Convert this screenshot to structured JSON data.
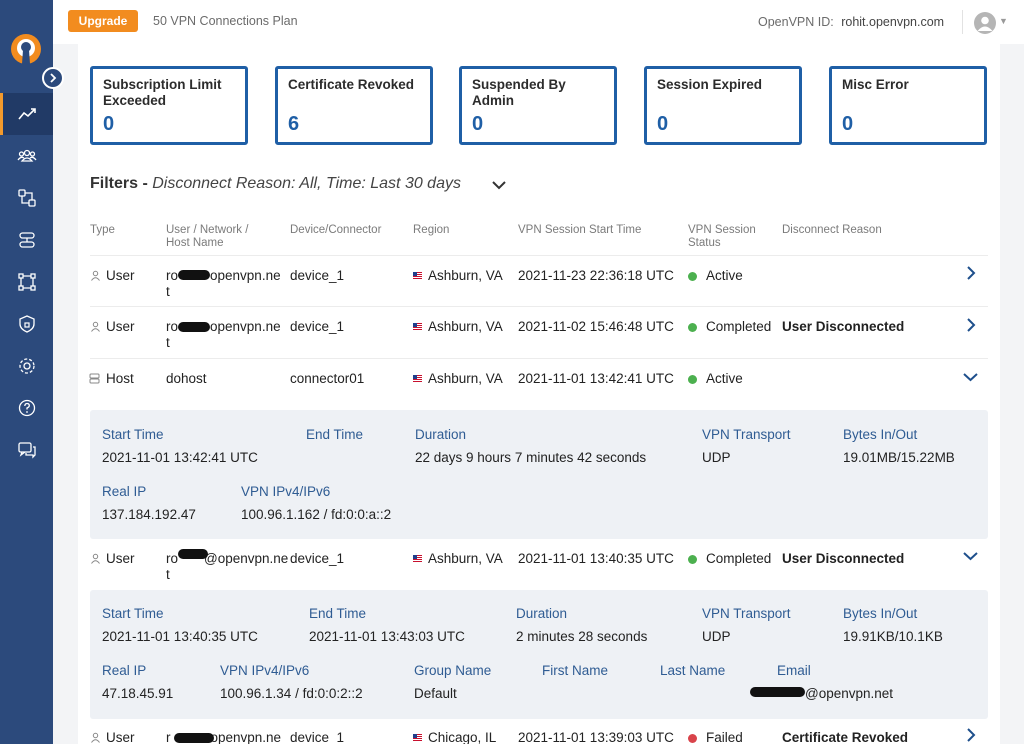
{
  "topbar": {
    "upgrade_label": "Upgrade",
    "plan": "50 VPN Connections Plan",
    "openvpn_id_label": "OpenVPN ID:",
    "openvpn_id_value": "rohit.openvpn.com"
  },
  "stats": [
    {
      "title": "Subscription Limit Exceeded",
      "value": "0"
    },
    {
      "title": "Certificate Revoked",
      "value": "6"
    },
    {
      "title": "Suspended By Admin",
      "value": "0"
    },
    {
      "title": "Session Expired",
      "value": "0"
    },
    {
      "title": "Misc Error",
      "value": "0"
    }
  ],
  "filters": {
    "label": "Filters - ",
    "value": "Disconnect Reason: All, Time: Last 30 days"
  },
  "columns": {
    "type": "Type",
    "user_1": "User / Network /",
    "user_2": "Host Name",
    "device": "Device/Connector",
    "region": "Region",
    "start": "VPN Session Start Time",
    "status_1": "VPN Session",
    "status_2": "Status",
    "reason": "Disconnect Reason"
  },
  "rows": [
    {
      "type": "User",
      "user_a": "ro",
      "user_b": "openvpn.ne",
      "user_c": "t",
      "device": "device_1",
      "region": "Ashburn, VA",
      "start": "2021-11-23 22:36:18 UTC",
      "status": "Active",
      "reason": ""
    },
    {
      "type": "User",
      "user_a": "ro",
      "user_b": "openvpn.ne",
      "user_c": "t",
      "device": "device_1",
      "region": "Ashburn, VA",
      "start": "2021-11-02 15:46:48 UTC",
      "status": "Completed",
      "reason": "User Disconnected"
    },
    {
      "type": "Host",
      "user_a": "dohost",
      "user_b": "",
      "user_c": "",
      "device": "connector01",
      "region": "Ashburn, VA",
      "start": "2021-11-01 13:42:41 UTC",
      "status": "Active",
      "reason": ""
    },
    {
      "type": "User",
      "user_a": "ro",
      "user_b": "@openvpn.ne",
      "user_c": "t",
      "device": "device_1",
      "region": "Ashburn, VA",
      "start": "2021-11-01 13:40:35 UTC",
      "status": "Completed",
      "reason": "User Disconnected"
    },
    {
      "type": "User",
      "user_a": "r",
      "user_b": "openvpn.ne",
      "user_c": "",
      "device": "device_1",
      "region": "Chicago, IL",
      "start": "2021-11-01 13:39:03 UTC",
      "status": "Failed",
      "reason": "Certificate Revoked"
    }
  ],
  "detail_labels": {
    "start_time": "Start Time",
    "end_time": "End Time",
    "duration": "Duration",
    "transport": "VPN Transport",
    "bytes": "Bytes In/Out",
    "real_ip": "Real IP",
    "vpn_ip": "VPN IPv4/IPv6",
    "group": "Group Name",
    "first": "First Name",
    "last": "Last Name",
    "email": "Email"
  },
  "detail1": {
    "start_time": "2021-11-01 13:42:41 UTC",
    "end_time": "",
    "duration": "22 days 9 hours 7 minutes 42 seconds",
    "transport": "UDP",
    "bytes": "19.01MB/15.22MB",
    "real_ip": "137.184.192.47",
    "vpn_ip": "100.96.1.162 / fd:0:0:a::2"
  },
  "detail2": {
    "start_time": "2021-11-01 13:40:35 UTC",
    "end_time": "2021-11-01 13:43:03 UTC",
    "duration": "2 minutes 28 seconds",
    "transport": "UDP",
    "bytes": "19.91KB/10.1KB",
    "real_ip": "47.18.45.91",
    "vpn_ip": "100.96.1.34 / fd:0:0:2::2",
    "group": "Default",
    "first": "",
    "last": "",
    "email": "@openvpn.net"
  },
  "colors": {
    "sidebar": "#2c4a7c",
    "accent_orange": "#f28c1f",
    "card_border": "#1f5fa6",
    "active_green": "#4cb04f",
    "failed_red": "#d9434a"
  },
  "icons": [
    "openvpn-logo-icon",
    "chevron-right-icon",
    "activity-chart-icon",
    "users-icon",
    "network-icon",
    "servers-icon",
    "connectors-icon",
    "shield-icon",
    "gear-icon",
    "help-icon",
    "chat-icon",
    "user-icon",
    "host-icon",
    "us-flag-icon",
    "chevron-down-icon"
  ]
}
